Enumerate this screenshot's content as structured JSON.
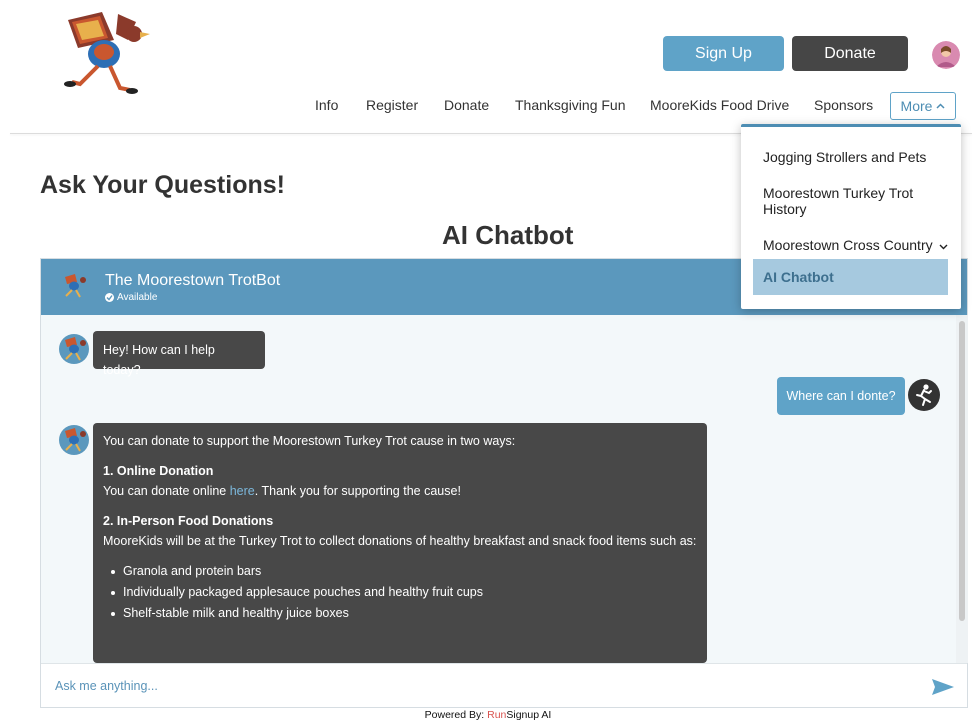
{
  "header": {
    "signup_label": "Sign Up",
    "donate_label": "Donate",
    "colors": {
      "signup": "#5fa3c8",
      "donate": "#464646"
    }
  },
  "nav": {
    "items": [
      "Info",
      "Register",
      "Donate",
      "Thanksgiving Fun",
      "MooreKids Food Drive",
      "Sponsors"
    ],
    "more_label": "More"
  },
  "dropdown": {
    "items": [
      "Jogging Strollers and Pets",
      "Moorestown Turkey Trot History",
      "Moorestown Cross Country"
    ],
    "active": "AI Chatbot"
  },
  "page": {
    "title": "Ask Your Questions!",
    "section_title": "AI Chatbot"
  },
  "chat": {
    "bot_name": "The Moorestown TrotBot",
    "status": "Available",
    "messages": {
      "greeting": "Hey! How can I help today?",
      "user_question": "Where can I donte?",
      "reply_intro": "You can donate to support the Moorestown Turkey Trot cause in two ways:",
      "online_heading": "1. Online Donation",
      "online_pre": "You can donate online ",
      "online_link": "here",
      "online_post": ". Thank you for supporting the cause!",
      "inperson_heading": "2. In-Person Food Donations",
      "inperson_text": "MooreKids will be at the Turkey Trot to collect donations of healthy breakfast and snack food items such as:",
      "items": [
        "Granola and protein bars",
        "Individually packaged applesauce pouches and healthy fruit cups",
        "Shelf-stable milk and healthy juice boxes"
      ]
    },
    "input_placeholder": "Ask me anything...",
    "colors": {
      "header": "#5b98bd",
      "bot_bubble": "#484848",
      "user_bubble": "#5fa3c8"
    }
  },
  "footer": {
    "powered_label": "Powered By:",
    "brand_run": "Run",
    "brand_rest": "Signup AI"
  },
  "icons": [
    "logo-turkey",
    "user-avatar-icon",
    "chevron-up-icon",
    "chevron-down-icon",
    "check-circle-icon",
    "runner-icon",
    "send-icon"
  ]
}
